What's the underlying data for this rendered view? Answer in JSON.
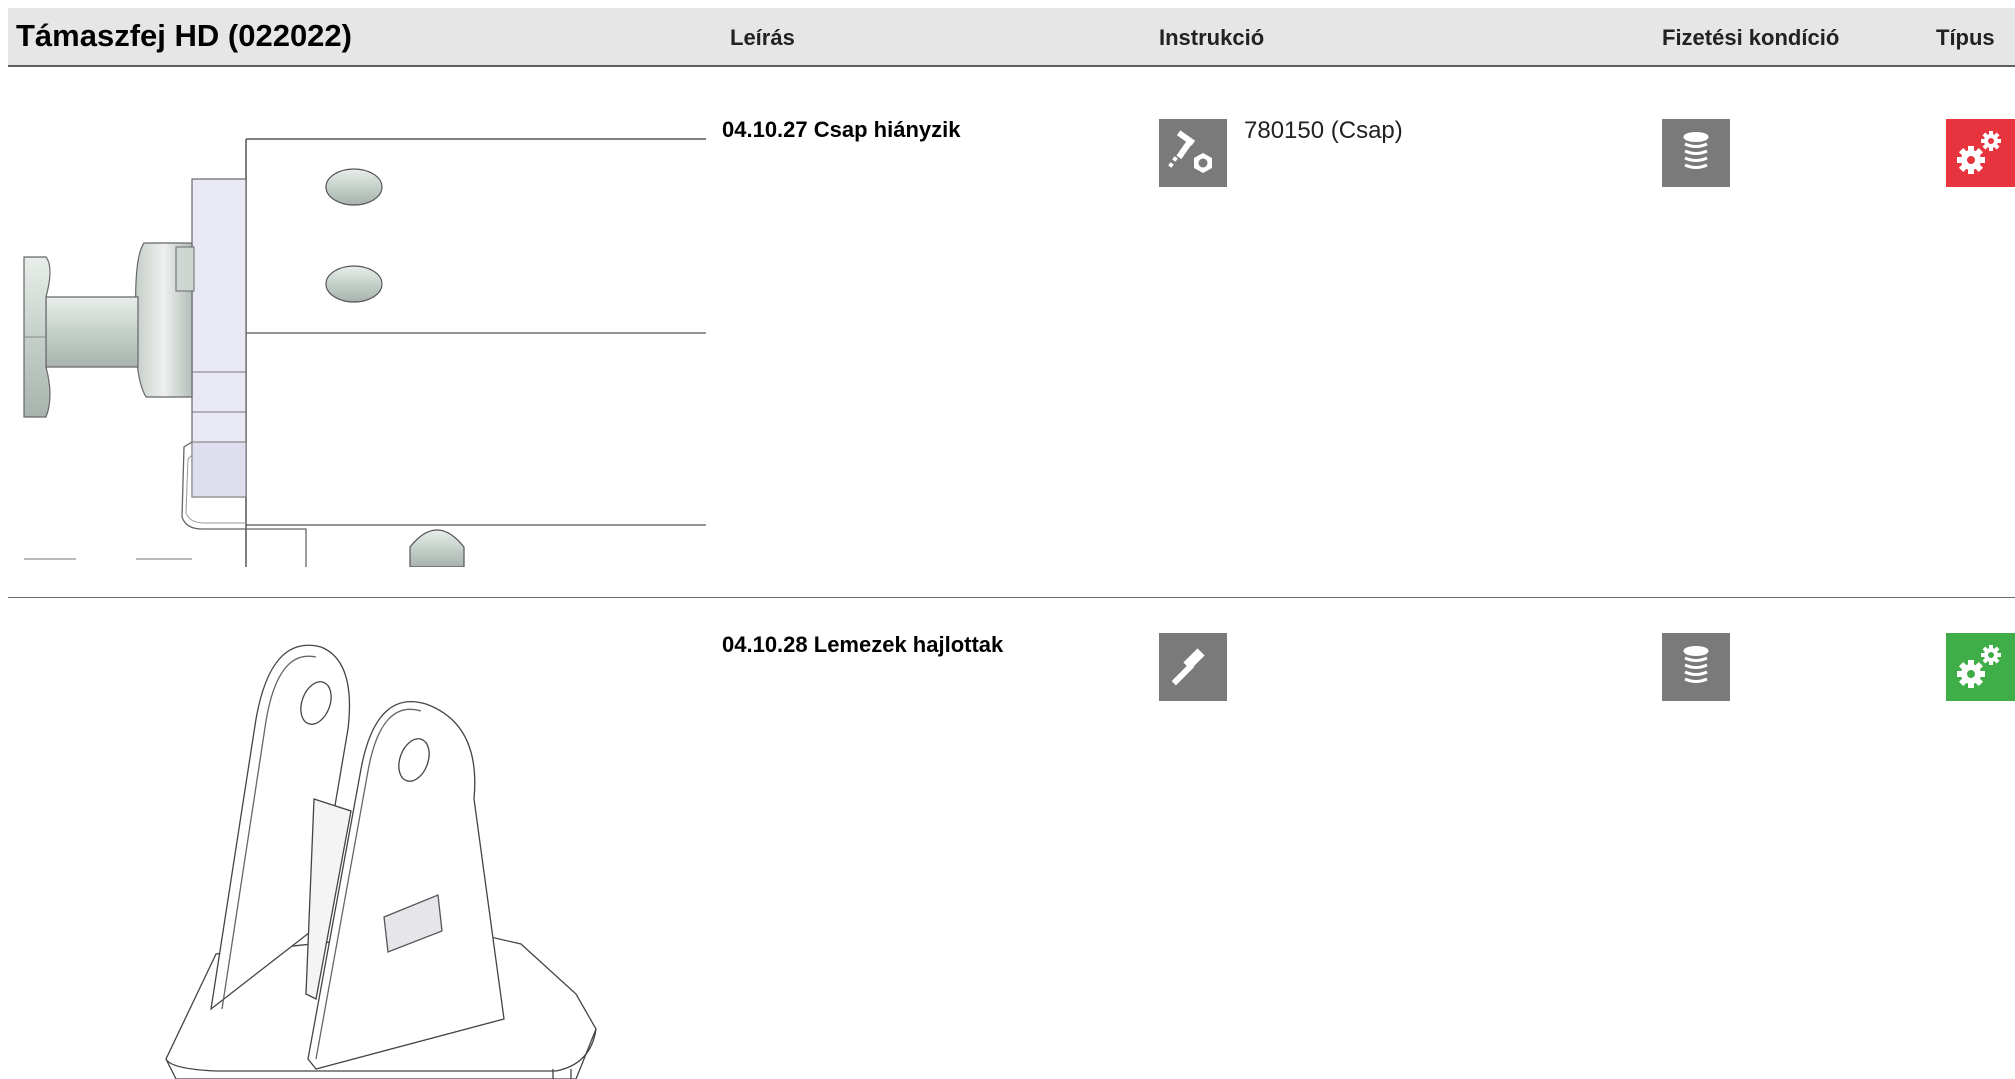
{
  "header": {
    "title": "Támaszfej HD (022022)",
    "columns": {
      "description": "Leírás",
      "instruction": "Instrukció",
      "payment": "Fizetési kondíció",
      "type": "Típus"
    }
  },
  "rows": [
    {
      "description": "04.10.27 Csap hiányzik",
      "instruction_text": "780150 (Csap)",
      "instruction_icon": "bolt-nut-icon",
      "payment_icon": "coin-stack-icon",
      "type_icon": "gears-icon",
      "type_color": "#e8343f"
    },
    {
      "description": "04.10.28 Lemezek hajlottak",
      "instruction_text": "",
      "instruction_icon": "hammer-icon",
      "payment_icon": "coin-stack-icon",
      "type_icon": "gears-icon",
      "type_color": "#3fae49"
    }
  ],
  "colors": {
    "header_bg": "#e6e6e6",
    "icon_tile": "#7a7a7a",
    "type_red": "#e8343f",
    "type_green": "#3fae49"
  }
}
